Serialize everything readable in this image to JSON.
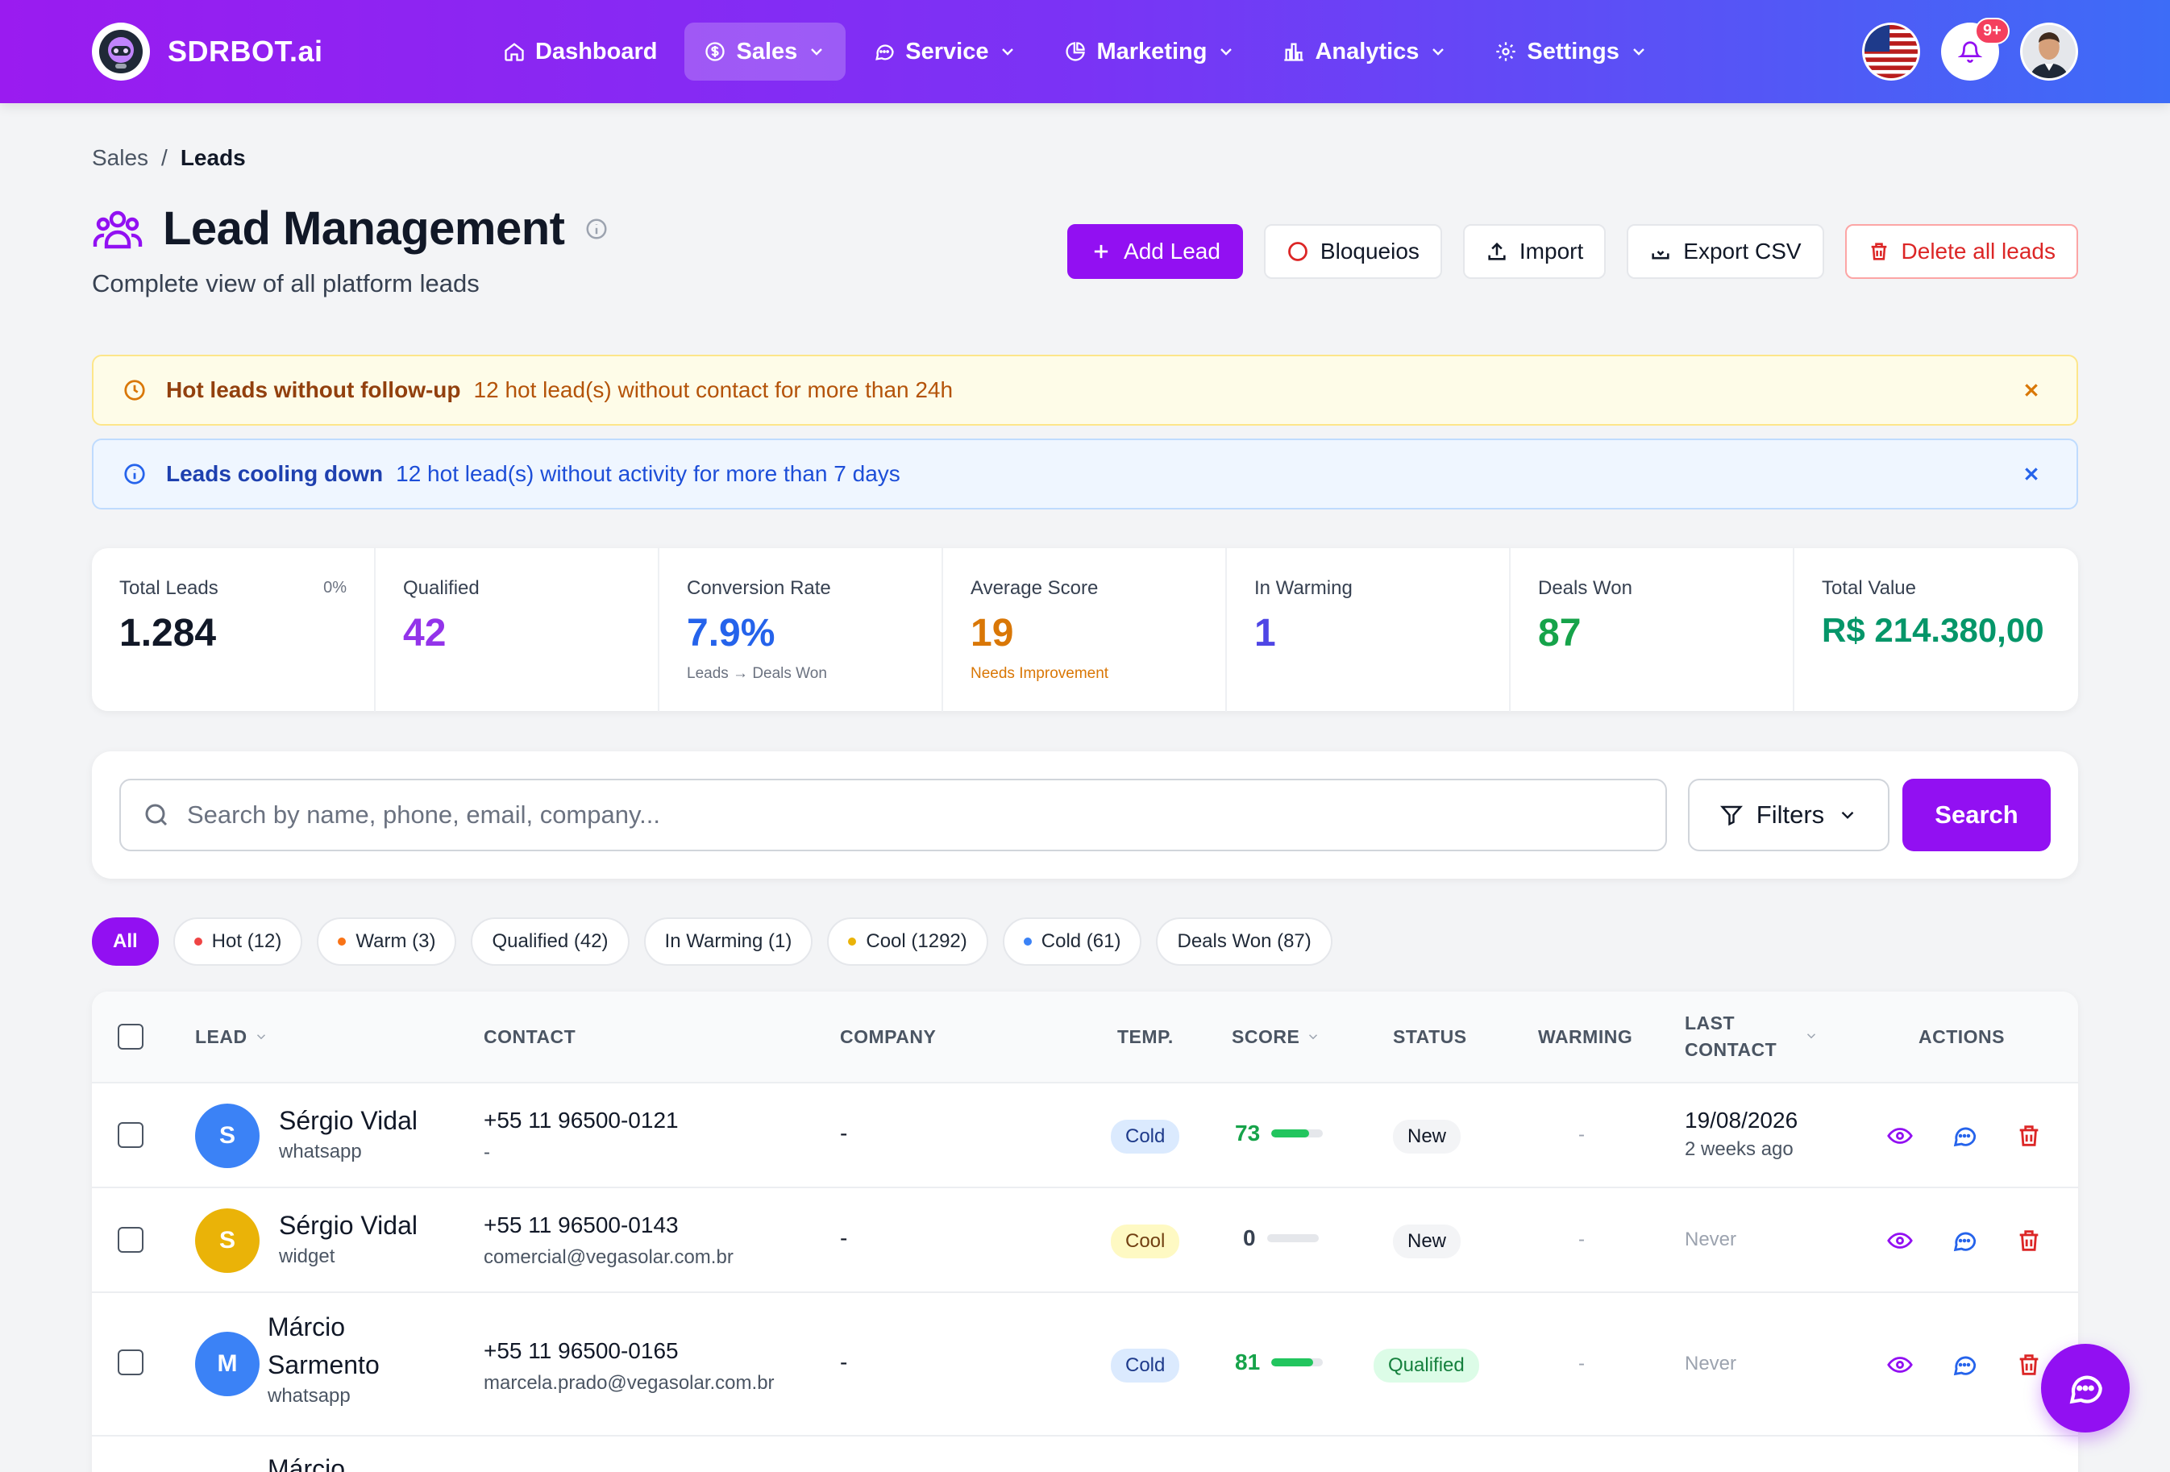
{
  "brand": {
    "name": "SDRBOT.ai"
  },
  "nav": [
    {
      "label": "Dashboard"
    },
    {
      "label": "Sales"
    },
    {
      "label": "Service"
    },
    {
      "label": "Marketing"
    },
    {
      "label": "Analytics"
    },
    {
      "label": "Settings"
    }
  ],
  "notifications": {
    "badge": "9+"
  },
  "breadcrumb": {
    "parent": "Sales",
    "separator": "/",
    "current": "Leads"
  },
  "page": {
    "title": "Lead Management",
    "subtitle": "Complete view of all platform leads"
  },
  "actions": {
    "add": "Add Lead",
    "blocks": "Bloqueios",
    "import": "Import",
    "export": "Export CSV",
    "delete_all": "Delete all leads"
  },
  "alerts": {
    "hot": {
      "title": "Hot leads without follow-up",
      "message": "12 hot lead(s) without contact for more than 24h"
    },
    "cooling": {
      "title": "Leads cooling down",
      "message": "12 hot lead(s) without activity for more than 7 days"
    }
  },
  "stats": [
    {
      "label": "Total Leads",
      "value": "1.284",
      "corner": "0%",
      "sub": "",
      "color": "#111827"
    },
    {
      "label": "Qualified",
      "value": "42",
      "corner": "",
      "sub": "",
      "color": "#9333ea"
    },
    {
      "label": "Conversion Rate",
      "value": "7.9%",
      "corner": "",
      "sub": "Leads → Deals Won",
      "color": "#2563eb"
    },
    {
      "label": "Average Score",
      "value": "19",
      "corner": "",
      "sub": "Needs Improvement",
      "color": "#d97706"
    },
    {
      "label": "In Warming",
      "value": "1",
      "corner": "",
      "sub": "",
      "color": "#4f46e5"
    },
    {
      "label": "Deals Won",
      "value": "87",
      "corner": "",
      "sub": "",
      "color": "#16a34a"
    },
    {
      "label": "Total Value",
      "value": "R$ 214.380,00",
      "corner": "",
      "sub": "",
      "color": "#059669"
    }
  ],
  "search": {
    "placeholder": "Search by name, phone, email, company...",
    "filters": "Filters",
    "button": "Search"
  },
  "chips": [
    {
      "label": "All",
      "dot": ""
    },
    {
      "label": "Hot (12)",
      "dot": "#ef4444"
    },
    {
      "label": "Warm (3)",
      "dot": "#f97316"
    },
    {
      "label": "Qualified (42)",
      "dot": ""
    },
    {
      "label": "In Warming (1)",
      "dot": ""
    },
    {
      "label": "Cool (1292)",
      "dot": "#eab308"
    },
    {
      "label": "Cold (61)",
      "dot": "#3b82f6"
    },
    {
      "label": "Deals Won (87)",
      "dot": ""
    }
  ],
  "table": {
    "columns": {
      "lead": "LEAD",
      "contact": "CONTACT",
      "company": "COMPANY",
      "temp": "TEMP.",
      "score": "SCORE",
      "status": "STATUS",
      "warming": "WARMING",
      "last_contact_1": "LAST",
      "last_contact_2": "CONTACT",
      "actions": "ACTIONS"
    },
    "rows": [
      {
        "initial": "S",
        "avatar_color": "#3b82f6",
        "name": "Sérgio Vidal",
        "source": "whatsapp",
        "phone": "+55 11 96500-0121",
        "email": "-",
        "company": "-",
        "temp": "Cold",
        "score": "73",
        "score_pct": 0.73,
        "status": "New",
        "warming": "-",
        "last_contact": "19/08/2026",
        "last_contact_ago": "2 weeks ago"
      },
      {
        "initial": "S",
        "avatar_color": "#eab308",
        "name": "Sérgio Vidal",
        "source": "widget",
        "phone": "+55 11 96500-0143",
        "email": "comercial@vegasolar.com.br",
        "company": "-",
        "temp": "Cool",
        "score": "0",
        "score_pct": 0,
        "status": "New",
        "warming": "-",
        "last_contact": "Never",
        "last_contact_ago": ""
      },
      {
        "initial": "M",
        "avatar_color": "#3b82f6",
        "name_line1": "Márcio",
        "name_line2": "Sarmento",
        "source": "whatsapp",
        "phone": "+55 11 96500-0165",
        "email": "marcela.prado@vegasolar.com.br",
        "company": "-",
        "temp": "Cold",
        "score": "81",
        "score_pct": 0.81,
        "status": "Qualified",
        "warming": "-",
        "last_contact": "Never",
        "last_contact_ago": ""
      },
      {
        "name_line1": "Márcio"
      }
    ]
  }
}
